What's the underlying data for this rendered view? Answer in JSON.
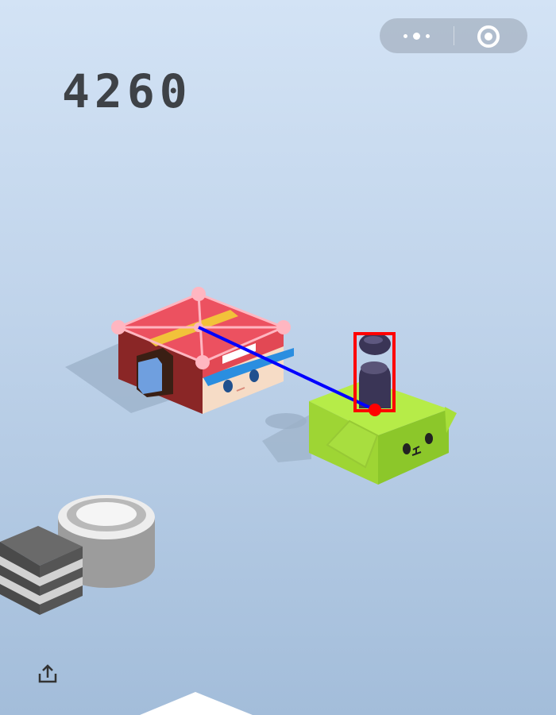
{
  "game": {
    "score": "4260"
  },
  "header": {
    "menu_icon": "more-dots-icon",
    "close_icon": "target-circle-icon"
  },
  "footer": {
    "share_icon": "share-upload-icon"
  },
  "overlay": {
    "bbox_color": "#ff0000",
    "trajectory_color": "#0000ff",
    "target_marker_color": "#ffb6c1",
    "player_anchor_color": "#ff0000"
  },
  "colors": {
    "background_top": "#d3e3f5",
    "background_bottom": "#a3bdda",
    "score_text": "#3e4247",
    "player_body": "#3a3556",
    "target_box_top": "#ec5160",
    "current_block_top": "#b6ec48"
  }
}
